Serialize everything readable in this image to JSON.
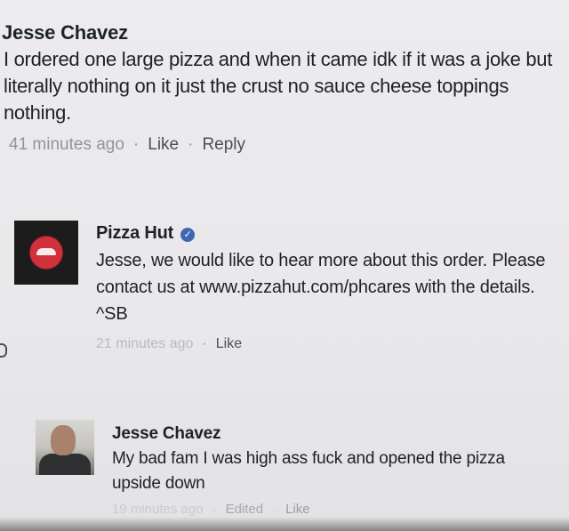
{
  "comments": [
    {
      "author": "Jesse Chavez",
      "text": "I ordered one large pizza and when it came idk if it was a joke but literally nothing on it just the crust no sauce cheese toppings nothing.",
      "time": "41 minutes ago",
      "separator": "·",
      "like_label": "Like",
      "reply_label": "Reply"
    },
    {
      "author": "Pizza Hut",
      "verified_badge": "✓",
      "text": "Jesse, we would like to hear more about this order. Please contact us at www.pizzahut.com/phcares with the details. ^SB",
      "time": "21 minutes ago",
      "separator": "·",
      "like_label": "Like"
    },
    {
      "author": "Jesse Chavez",
      "text": "My bad fam I was high ass fuck and opened the pizza upside down",
      "time": "19 minutes ago",
      "separator": "·",
      "edited_label": "Edited",
      "like_label": "Like"
    }
  ],
  "colors": {
    "text": "#1d2129",
    "meta": "#90949c",
    "verified": "#4267b2",
    "pizza_hut_red": "#d1313a"
  },
  "icons": {
    "pizza_hut_logo": "pizza-hut-logo-icon",
    "verified": "verified-check-icon",
    "user_photo": "user-avatar"
  }
}
